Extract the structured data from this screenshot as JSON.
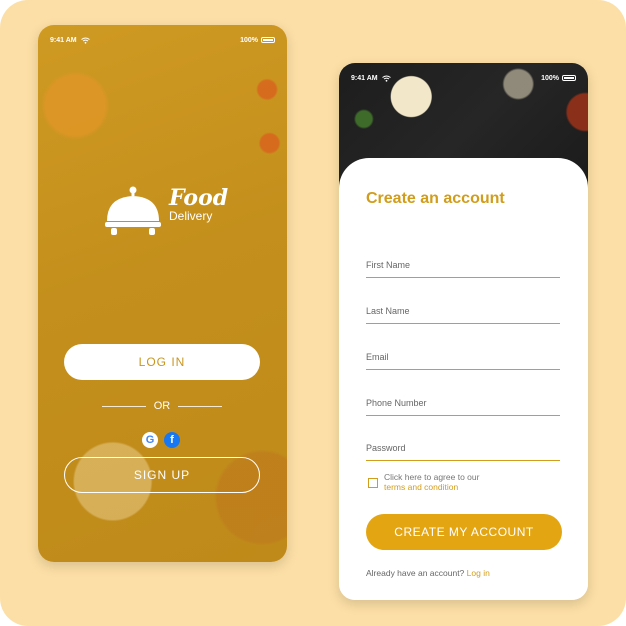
{
  "left_screen": {
    "status": {
      "time": "9:41 AM",
      "battery": "100%"
    },
    "logo": {
      "title": "Food",
      "subtitle": "Delivery"
    },
    "login_label": "LOG IN",
    "or_label": "OR",
    "google_letter": "G",
    "facebook_letter": "f",
    "signup_label": "SIGN UP"
  },
  "right_screen": {
    "status": {
      "time": "9:41 AM",
      "battery": "100%"
    },
    "title": "Create an account",
    "fields": {
      "first_name": "First Name",
      "last_name": "Last Name",
      "email": "Email",
      "phone": "Phone Number",
      "password": "Password"
    },
    "agree_text": "Click here to agree to our",
    "agree_link": "terms and condition",
    "create_label": "CREATE MY ACCOUNT",
    "have_account": "Already have an account?",
    "login_link": "Log in"
  },
  "colors": {
    "accent": "#e4a512",
    "background": "#fcdfa6"
  },
  "icons": [
    "wifi-icon",
    "battery-icon",
    "cloche-icon",
    "google-icon",
    "facebook-icon",
    "checkbox-icon"
  ]
}
